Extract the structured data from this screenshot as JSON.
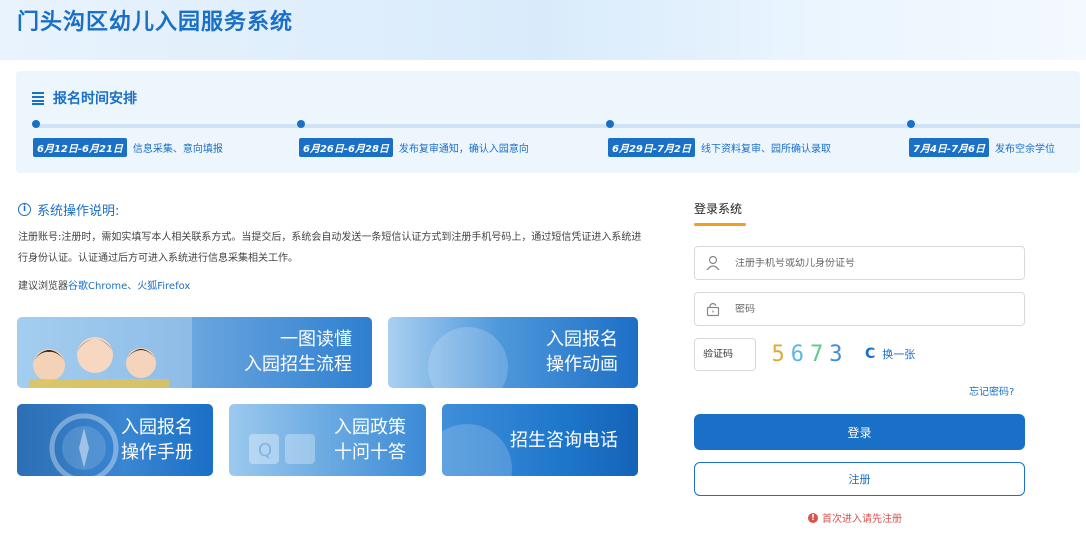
{
  "header": {
    "title": "门头沟区幼儿入园服务系统"
  },
  "schedule": {
    "title": "报名时间安排",
    "items": [
      {
        "date": "6月12日-6月21日",
        "text": "信息采集、意向填报"
      },
      {
        "date": "6月26日-6月28日",
        "text": "发布复审通知，确认入园意向"
      },
      {
        "date": "6月29日-7月2日",
        "text": "线下资料复审、园所确认录取"
      },
      {
        "date": "7月4日-7月6日",
        "text": "发布空余学位"
      }
    ]
  },
  "notice": {
    "title": "系统操作说明:",
    "text": "注册账号:注册时，需如实填写本人相关联系方式。当提交后，系统会自动发送一条短信认证方式到注册手机号码上，通过短信凭证进入系统进行身份认证。认证通过后方可进入系统进行信息采集相关工作。",
    "browser_prefix": "建议浏览器",
    "browser_names": "谷歌Chrome、火狐Firefox"
  },
  "tiles": {
    "t1_line1": "一图读懂",
    "t1_line2": "入园招生流程",
    "t2_line1": "入园报名",
    "t2_line2": "操作动画",
    "t3_line1": "入园报名",
    "t3_line2": "操作手册",
    "t4_line1": "入园政策",
    "t4_line2": "十问十答",
    "t5_line1": "招生咨询电话"
  },
  "login": {
    "tab": "登录系统",
    "account_placeholder": "注册手机号或幼儿身份证号",
    "password_placeholder": "密码",
    "captcha_placeholder": "验证码",
    "captcha_digits": [
      "5",
      "6",
      "7",
      "3"
    ],
    "captcha_colors": [
      "#e0a93a",
      "#5cb7e8",
      "#5fc98c",
      "#3d8fd8"
    ],
    "refresh_label": "换一张",
    "forgot_label": "忘记密码?",
    "login_button": "登录",
    "register_button": "注册",
    "first_tip": "首次进入请先注册"
  }
}
